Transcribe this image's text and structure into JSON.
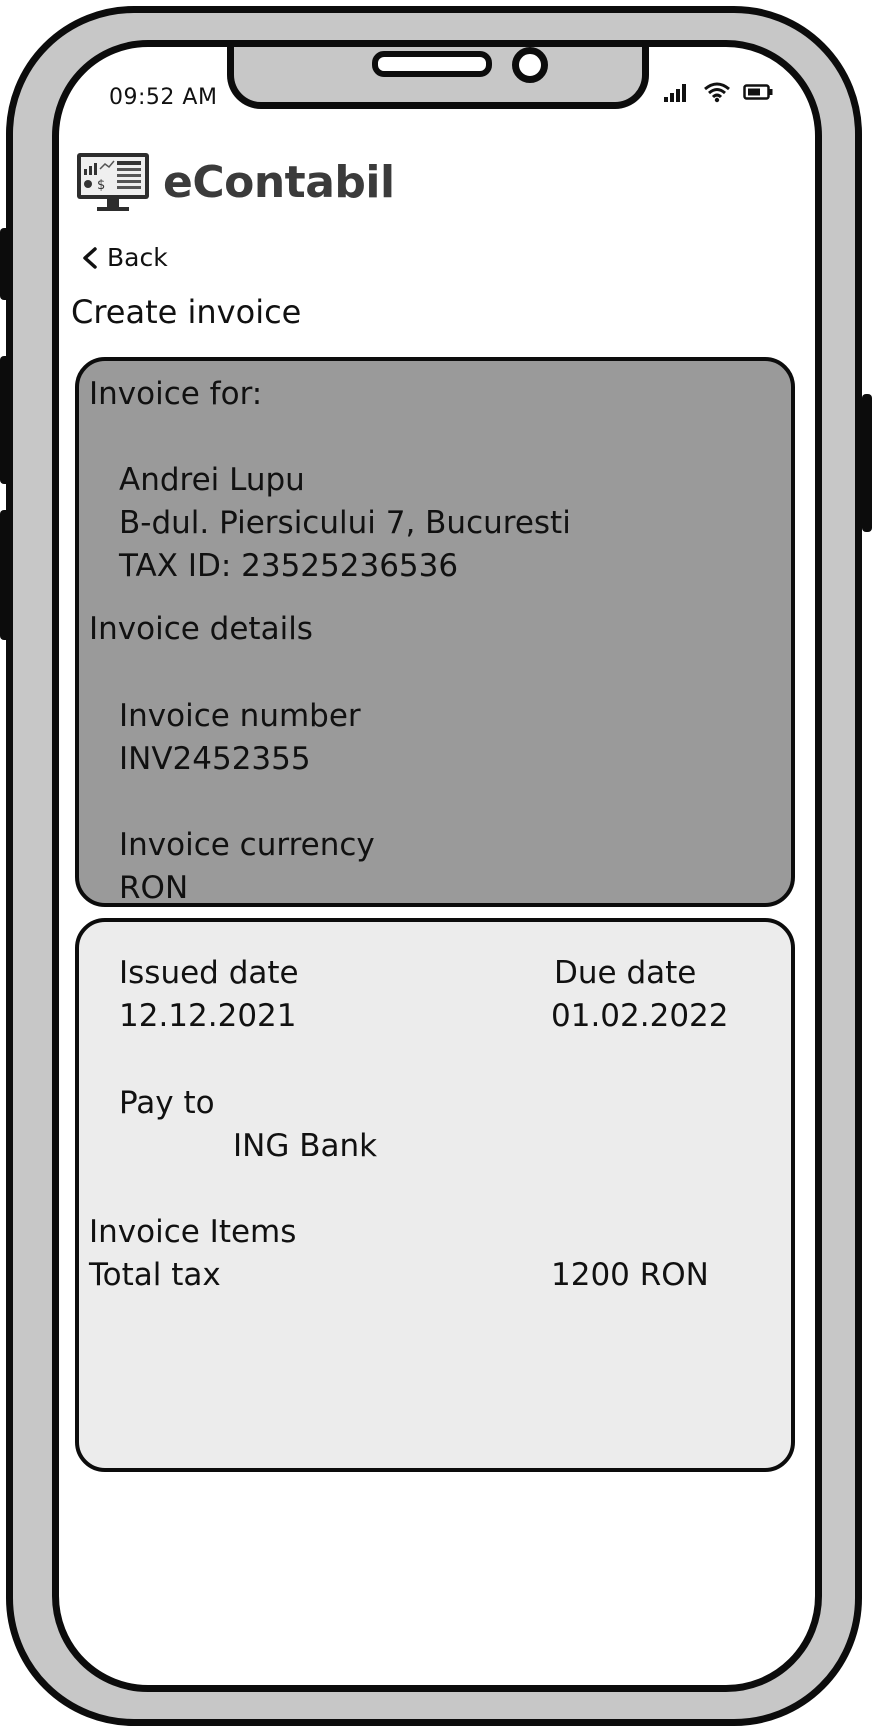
{
  "status_bar": {
    "time": "09:52 AM",
    "icons": [
      "signal-icon",
      "wifi-icon",
      "battery-icon"
    ]
  },
  "brand": {
    "name": "eContabil",
    "logo_icon": "monitor-finance-icon"
  },
  "nav": {
    "back_label": "Back"
  },
  "page": {
    "title": "Create invoice"
  },
  "invoice_for": {
    "heading": "Invoice for:",
    "name": "Andrei Lupu",
    "address": "B-dul. Piersicului 7, Bucuresti",
    "tax_id": "TAX ID: 23525236536"
  },
  "invoice_details": {
    "heading": "Invoice details",
    "number_label": "Invoice number",
    "number_value": "INV2452355",
    "currency_label": "Invoice currency",
    "currency_value": "RON"
  },
  "dates": {
    "issued_label": "Issued date",
    "issued_value": "12.12.2021",
    "due_label": "Due date",
    "due_value": "01.02.2022"
  },
  "payment": {
    "pay_to_label": "Pay to",
    "pay_to_value": "ING Bank"
  },
  "items": {
    "heading": "Invoice Items",
    "total_tax_label": "Total tax",
    "total_tax_value": "1200 RON"
  },
  "colors": {
    "dark_card": "#9a9a9a",
    "light_card": "#ececec",
    "frame": "#c7c7c7",
    "outline": "#0c0c0c"
  }
}
